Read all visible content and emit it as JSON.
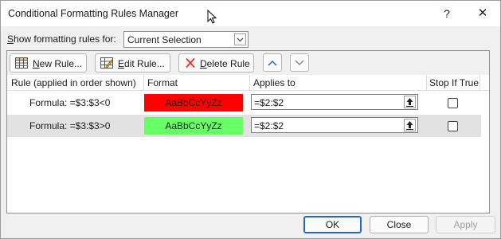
{
  "window": {
    "title": "Conditional Formatting Rules Manager",
    "help": "?",
    "close": "✕"
  },
  "show_rules": {
    "label": "Show formatting rules for:",
    "value": "Current Selection"
  },
  "toolbar": {
    "new_rule": "New Rule...",
    "edit_rule": "Edit Rule...",
    "delete_rule": "Delete Rule"
  },
  "table": {
    "headers": [
      "Rule (applied in order shown)",
      "Format",
      "Applies to",
      "Stop If True"
    ],
    "rows": [
      {
        "rule": "Formula: =$3:$3<0",
        "format_preview": "AaBbCcYyZz",
        "format_color": "#ff0000",
        "applies_to": "=$2:$2",
        "stop_if_true": false,
        "selected": false
      },
      {
        "rule": "Formula: =$3:$3>0",
        "format_preview": "AaBbCcYyZz",
        "format_color": "#66ff66",
        "applies_to": "=$2:$2",
        "stop_if_true": false,
        "selected": true
      }
    ]
  },
  "buttons": {
    "ok": "OK",
    "close": "Close",
    "apply": "Apply"
  },
  "colors": {
    "accent": "#2467c4",
    "selected_row": "#e2e2e2"
  }
}
